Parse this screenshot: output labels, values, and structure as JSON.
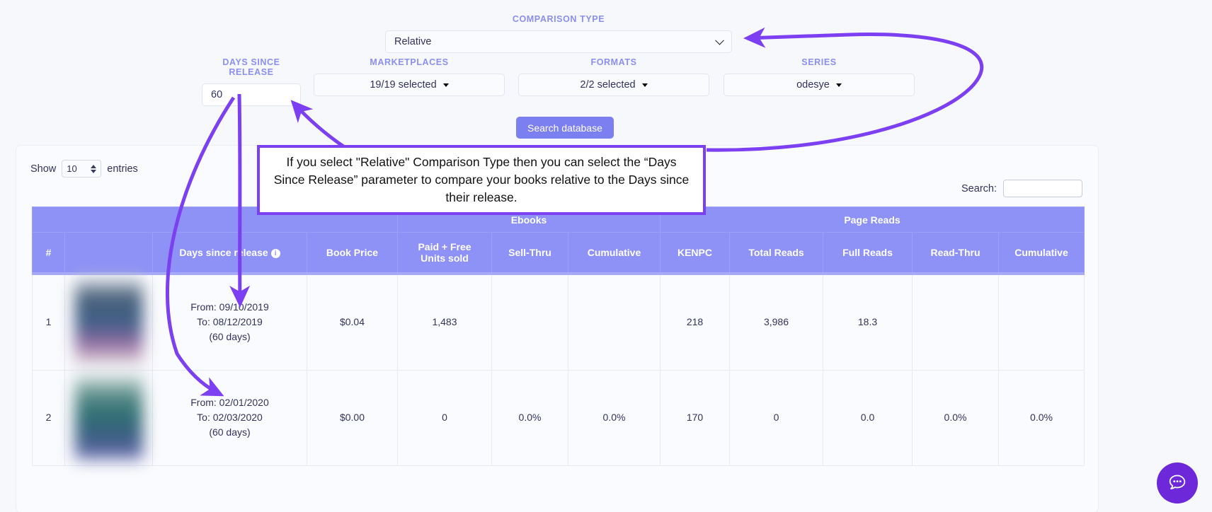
{
  "filters": {
    "comparison_type": {
      "label": "COMPARISON TYPE",
      "value": "Relative",
      "icon": "chevron-down-icon"
    },
    "days_since_release": {
      "label": "DAYS SINCE RELEASE",
      "value": "60",
      "placeholder": ""
    },
    "marketplaces": {
      "label": "MARKETPLACES",
      "value": "19/19 selected",
      "icon": "caret-down-icon"
    },
    "formats": {
      "label": "FORMATS",
      "value": "2/2 selected",
      "icon": "caret-down-icon"
    },
    "series": {
      "label": "SERIES",
      "value": "odesye",
      "icon": "caret-down-icon"
    },
    "search_button": "Search database"
  },
  "annotation": {
    "text": "If you select \"Relative\" Comparison Type then you can select the “Days Since Release” parameter to compare your books relative to the   Days since their release.",
    "border_color": "#7c3ff2",
    "arrow_color": "#7c3ff2"
  },
  "table_controls": {
    "show_label": "Show",
    "entries_label": "entries",
    "entries_value": "10",
    "search_label": "Search:",
    "search_value": "",
    "search_placeholder": ""
  },
  "table": {
    "group_headers": [
      {
        "label": "",
        "span": 4
      },
      {
        "label": "Ebooks",
        "span": 3
      },
      {
        "label": "Page Reads",
        "span": 5
      }
    ],
    "columns": [
      "#",
      "",
      "Days since release",
      "Book Price",
      "Paid + Free\nUnits sold",
      "Sell-Thru",
      "Cumulative",
      "KENPC",
      "Total Reads",
      "Full Reads",
      "Read-Thru",
      "Cumulative"
    ],
    "days_since_release_info_icon": "info-icon",
    "rows": [
      {
        "index": "1",
        "cover": "book-cover-1",
        "from": "From: 09/10/2019",
        "to": "To: 08/12/2019",
        "days": "(60 days)",
        "book_price": "$0.04",
        "paid_free_units": "1,483",
        "sell_thru": "",
        "cumulative_ebooks": "",
        "kenpc": "218",
        "total_reads": "3,986",
        "full_reads": "18.3",
        "read_thru": "",
        "cumulative_reads": ""
      },
      {
        "index": "2",
        "cover": "book-cover-2",
        "from": "From: 02/01/2020",
        "to": "To: 02/03/2020",
        "days": "(60 days)",
        "book_price": "$0.00",
        "paid_free_units": "0",
        "sell_thru": "0.0%",
        "cumulative_ebooks": "0.0%",
        "kenpc": "170",
        "total_reads": "0",
        "full_reads": "0.0",
        "read_thru": "0.0%",
        "cumulative_reads": "0.0%"
      }
    ]
  },
  "chat_widget": {
    "icon": "chat-bubble-icon"
  },
  "colors": {
    "accent": "#7b7ff0",
    "header": "#8e91f5",
    "label": "#8b8ff0",
    "annotation": "#7c3ff2",
    "chat": "#6d28d9"
  }
}
